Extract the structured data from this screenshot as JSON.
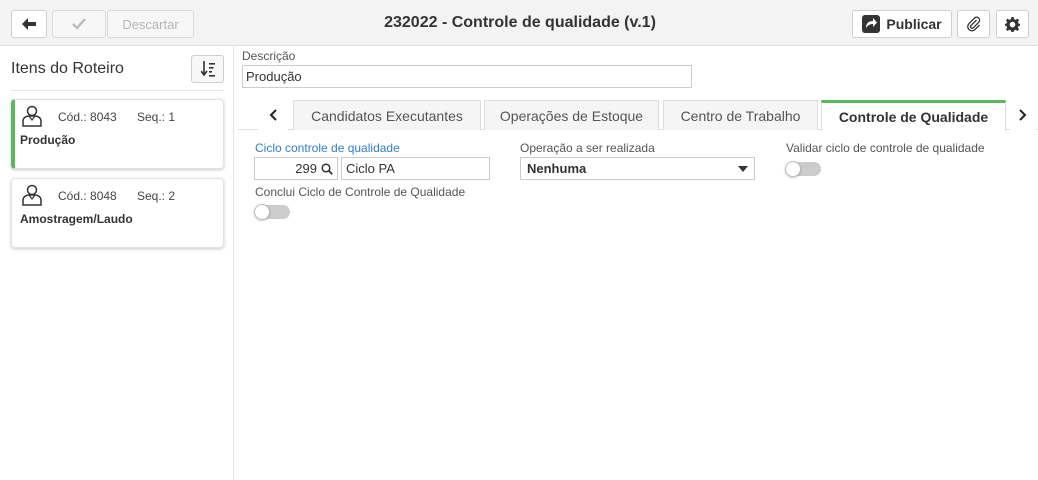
{
  "toolbar": {
    "back_icon": "arrow-left-icon",
    "confirm_icon": "check-icon",
    "discard_label": "Descartar",
    "title": "232022 - Controle de qualidade (v.1)",
    "publish_label": "Publicar",
    "publish_icon": "share-icon",
    "attach_icon": "paperclip-icon",
    "settings_icon": "gear-icon"
  },
  "sidebar": {
    "title": "Itens do Roteiro",
    "sort_icon": "sort-icon",
    "items": [
      {
        "code": "Cód.: 8043",
        "seq": "Seq.: 1",
        "name": "Produção",
        "active": true
      },
      {
        "code": "Cód.: 8048",
        "seq": "Seq.: 2",
        "name": "Amostragem/Laudo",
        "active": false
      }
    ]
  },
  "main": {
    "description_label": "Descrição",
    "description_value": "Produção",
    "tabs": [
      {
        "label": "Candidatos Executantes"
      },
      {
        "label": "Operações de Estoque"
      },
      {
        "label": "Centro de Trabalho"
      },
      {
        "label": "Controle de Qualidade",
        "active": true
      }
    ],
    "quality": {
      "cycle_label": "Ciclo controle de qualidade",
      "cycle_code": "299",
      "cycle_name": "Ciclo PA",
      "operation_label": "Operação a ser realizada",
      "operation_value": "Nenhuma",
      "validate_label": "Validar ciclo de controle de qualidade",
      "validate_on": false,
      "conclude_label": "Conclui Ciclo de Controle de Qualidade",
      "conclude_on": false
    }
  },
  "colors": {
    "accent_green": "#5cb85c",
    "link_blue": "#2f7fd0"
  }
}
